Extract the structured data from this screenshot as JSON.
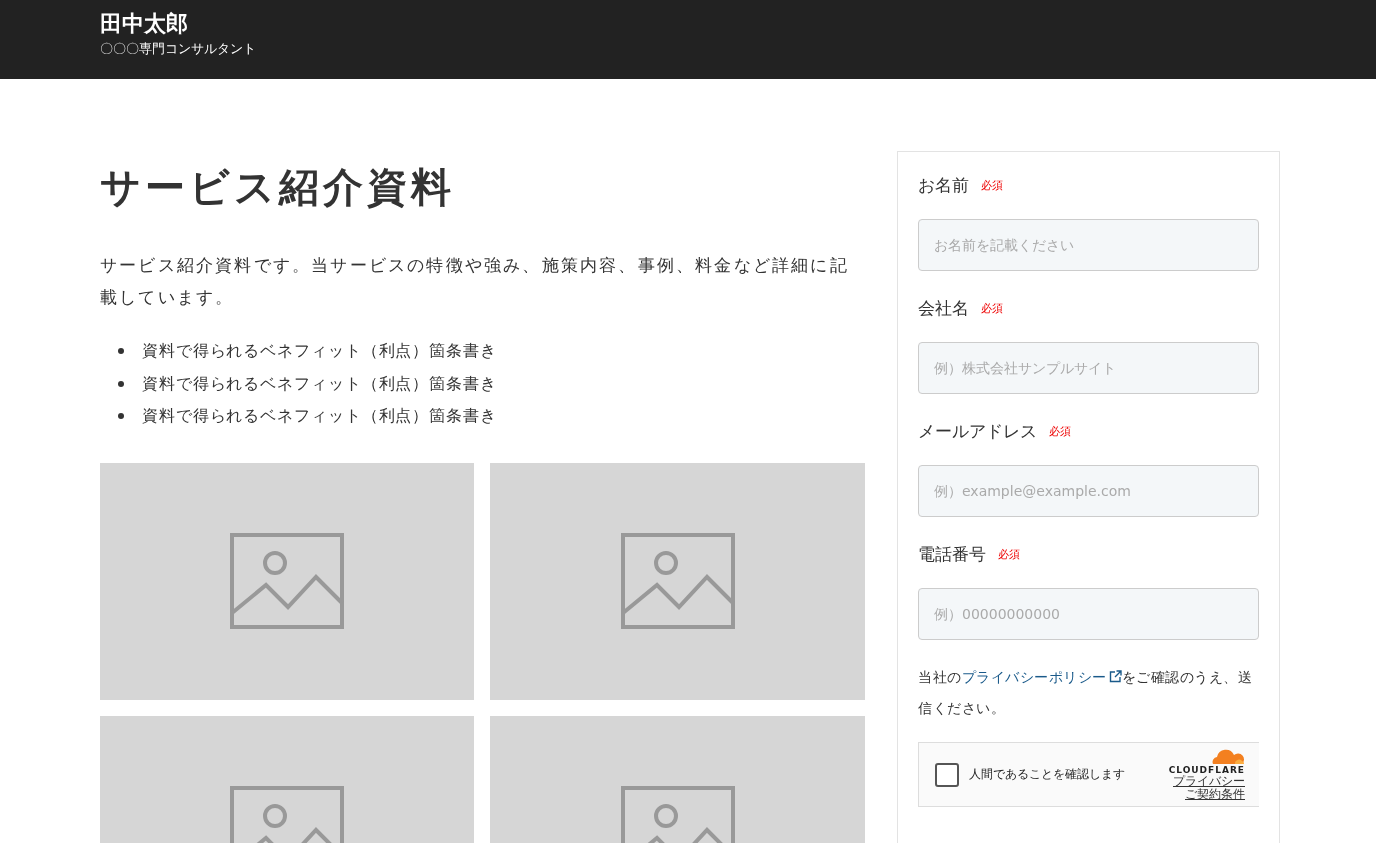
{
  "header": {
    "name": "田中太郎",
    "tagline": "〇〇〇専門コンサルタント"
  },
  "main": {
    "title": "サービス紹介資料",
    "description": "サービス紹介資料です。当サービスの特徴や強み、施策内容、事例、料金など詳細に記載しています。",
    "benefits": [
      "資料で得られるベネフィット（利点）箇条書き",
      "資料で得られるベネフィット（利点）箇条書き",
      "資料で得られるベネフィット（利点）箇条書き"
    ],
    "images": [
      {
        "kind": "placeholder"
      },
      {
        "kind": "placeholder"
      },
      {
        "kind": "placeholder"
      },
      {
        "kind": "placeholder"
      }
    ]
  },
  "form": {
    "fields": [
      {
        "label": "お名前",
        "badge": "必須",
        "placeholder": "お名前を記載ください"
      },
      {
        "label": "会社名",
        "badge": "必須",
        "placeholder": "例）株式会社サンプルサイト"
      },
      {
        "label": "メールアドレス",
        "badge": "必須",
        "placeholder": "例）example@example.com"
      },
      {
        "label": "電話番号",
        "badge": "必須",
        "placeholder": "例）00000000000"
      }
    ],
    "consent": {
      "before": "当社の",
      "link": "プライバシーポリシー",
      "after": "をご確認のうえ、送信ください。"
    },
    "captcha": {
      "label": "人間であることを確認します",
      "checked": false,
      "brand": "CLOUDFLARE",
      "links": [
        "プライバシー",
        "ご契約条件"
      ]
    }
  }
}
